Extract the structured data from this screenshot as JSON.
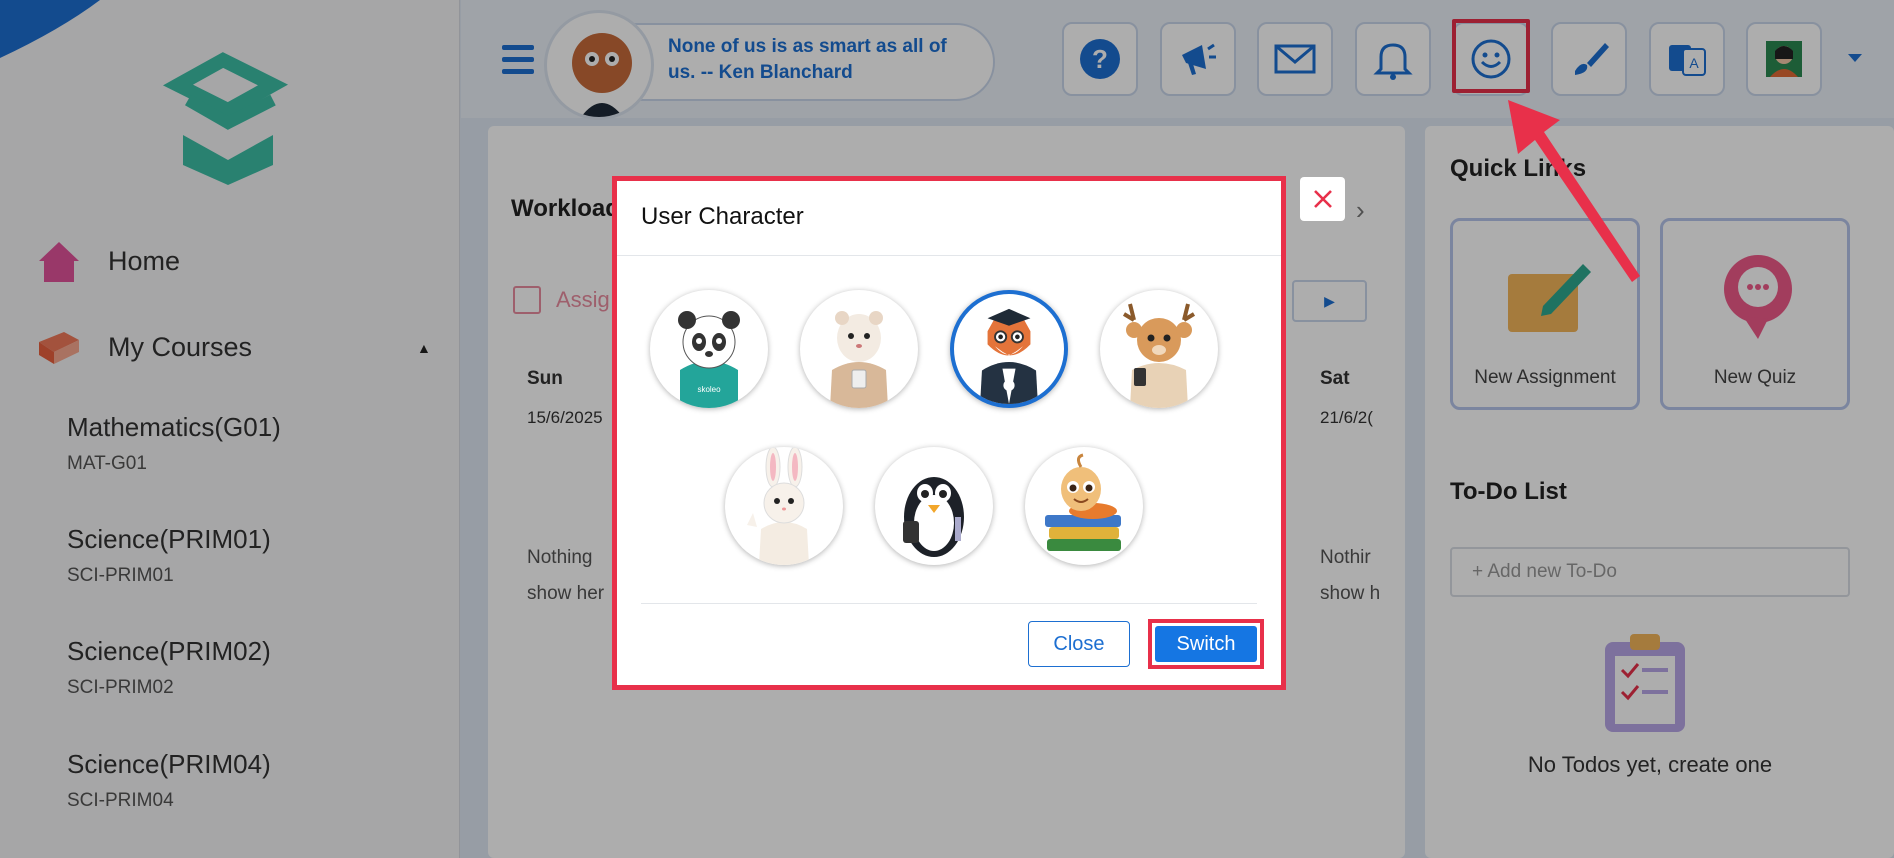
{
  "sidebar": {
    "items": [
      {
        "label": "Home",
        "icon": "home-icon"
      },
      {
        "label": "My Courses",
        "icon": "book-icon"
      }
    ],
    "courses": [
      {
        "name": "Mathematics(G01)",
        "code": "MAT-G01"
      },
      {
        "name": "Science(PRIM01)",
        "code": "SCI-PRIM01"
      },
      {
        "name": "Science(PRIM02)",
        "code": "SCI-PRIM02"
      },
      {
        "name": "Science(PRIM04)",
        "code": "SCI-PRIM04"
      }
    ]
  },
  "header": {
    "quote": "None of us is as smart as all of us. -- Ken Blanchard",
    "toolbar": [
      "help-icon",
      "megaphone-icon",
      "mail-icon",
      "bell-icon",
      "smiley-icon",
      "brush-icon",
      "translate-icon",
      "profile-avatar"
    ]
  },
  "main": {
    "workload_title": "Workload",
    "assign_label": "Assig",
    "days": [
      {
        "day": "Sun",
        "date": "15/6/2025"
      },
      {
        "day": "Sat",
        "date": "21/6/2("
      }
    ],
    "nothing_text_left": "Nothing",
    "nothing_text_left2": "show her",
    "nothing_text_right": "Nothir",
    "nothing_text_right2": "show h"
  },
  "right": {
    "quick_links_title": "Quick Links",
    "quick_links": [
      {
        "label": "New Assignment"
      },
      {
        "label": "New Quiz"
      }
    ],
    "todo_title": "To-Do List",
    "todo_placeholder": "+ Add new To-Do",
    "todo_empty": "No Todos yet, create one"
  },
  "modal": {
    "title": "User Character",
    "characters": [
      "panda",
      "ferret",
      "fox",
      "deer",
      "bunny",
      "penguin",
      "worm"
    ],
    "selected": "fox",
    "close_label": "Close",
    "switch_label": "Switch"
  },
  "colors": {
    "accent": "#1d6fd1",
    "highlight": "#e8304a"
  }
}
